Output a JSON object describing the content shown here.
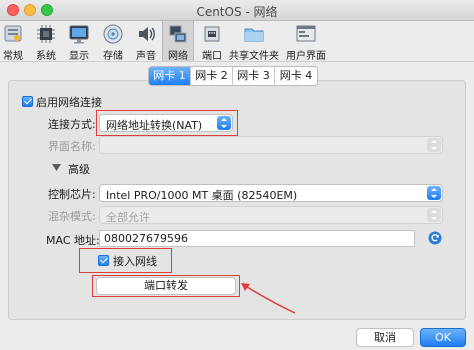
{
  "window": {
    "title": "CentOS - 网络"
  },
  "toolbar": {
    "items": [
      {
        "label": "常规",
        "icon": "general-icon"
      },
      {
        "label": "系统",
        "icon": "system-chip-icon"
      },
      {
        "label": "显示",
        "icon": "display-monitor-icon"
      },
      {
        "label": "存储",
        "icon": "storage-disk-icon"
      },
      {
        "label": "声音",
        "icon": "speaker-icon"
      },
      {
        "label": "网络",
        "icon": "network-icon"
      },
      {
        "label": "端口",
        "icon": "port-icon"
      },
      {
        "label": "共享文件夹",
        "icon": "shared-folder-icon"
      },
      {
        "label": "用户界面",
        "icon": "user-interface-icon"
      }
    ],
    "active_index": 5
  },
  "tabs": [
    "网卡 1",
    "网卡 2",
    "网卡 3",
    "网卡 4"
  ],
  "form": {
    "enable_adapter_label": "启用网络连接",
    "attached_to_label": "连接方式:",
    "attached_to_value": "网络地址转换(NAT)",
    "name_label": "界面名称:",
    "name_value": "",
    "advanced_label": "高级",
    "adapter_type_label": "控制芯片:",
    "adapter_type_value": "Intel PRO/1000 MT 桌面 (82540EM)",
    "promiscuous_label": "混杂模式:",
    "promiscuous_value": "全部允许",
    "mac_label": "MAC 地址:",
    "mac_value": "080027679596",
    "cable_connected_label": "接入网线",
    "port_forwarding_label": "端口转发"
  },
  "footer": {
    "cancel_label": "取消",
    "ok_label": "OK"
  },
  "colors": {
    "accent": "#1f7ef1",
    "highlight": "#e03c3c"
  }
}
